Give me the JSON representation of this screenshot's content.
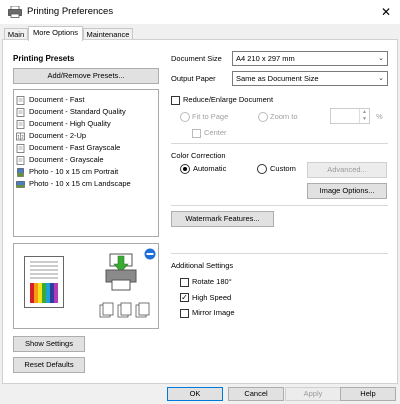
{
  "window": {
    "title": "Printing Preferences"
  },
  "tabs": [
    {
      "label": "Main",
      "active": false
    },
    {
      "label": "More Options",
      "active": true
    },
    {
      "label": "Maintenance",
      "active": false
    }
  ],
  "presets": {
    "heading": "Printing Presets",
    "add_remove_label": "Add/Remove Presets...",
    "items": [
      {
        "label": "Document - Fast",
        "icon": "document-icon"
      },
      {
        "label": "Document - Standard Quality",
        "icon": "document-icon"
      },
      {
        "label": "Document - High Quality",
        "icon": "document-icon"
      },
      {
        "label": "Document - 2-Up",
        "icon": "two-up-icon"
      },
      {
        "label": "Document - Fast Grayscale",
        "icon": "document-icon"
      },
      {
        "label": "Document - Grayscale",
        "icon": "document-icon"
      },
      {
        "label": "Photo - 10 x 15 cm Portrait",
        "icon": "photo-icon"
      },
      {
        "label": "Photo - 10 x 15 cm Landscape",
        "icon": "photo-icon"
      }
    ]
  },
  "settings": {
    "document_size_label": "Document Size",
    "document_size_value": "A4 210 x 297 mm",
    "output_paper_label": "Output Paper",
    "output_paper_value": "Same as Document Size",
    "reduce_enlarge_label": "Reduce/Enlarge Document",
    "fit_to_page_label": "Fit to Page",
    "zoom_to_label": "Zoom to",
    "zoom_unit": "%",
    "center_label": "Center"
  },
  "color_correction": {
    "heading": "Color Correction",
    "automatic_label": "Automatic",
    "custom_label": "Custom",
    "advanced_label": "Advanced...",
    "image_options_label": "Image Options..."
  },
  "watermark_label": "Watermark Features...",
  "additional": {
    "heading": "Additional Settings",
    "rotate_label": "Rotate 180°",
    "high_speed_label": "High Speed",
    "mirror_label": "Mirror Image",
    "high_speed_checked": true
  },
  "bottom_left": {
    "show_settings_label": "Show Settings",
    "reset_defaults_label": "Reset Defaults"
  },
  "footer": {
    "ok_label": "OK",
    "cancel_label": "Cancel",
    "apply_label": "Apply",
    "help_label": "Help"
  },
  "colors": {
    "accent": "#0078d7",
    "arrow_green": "#3aaa35",
    "status_blue": "#1e6fd9"
  }
}
